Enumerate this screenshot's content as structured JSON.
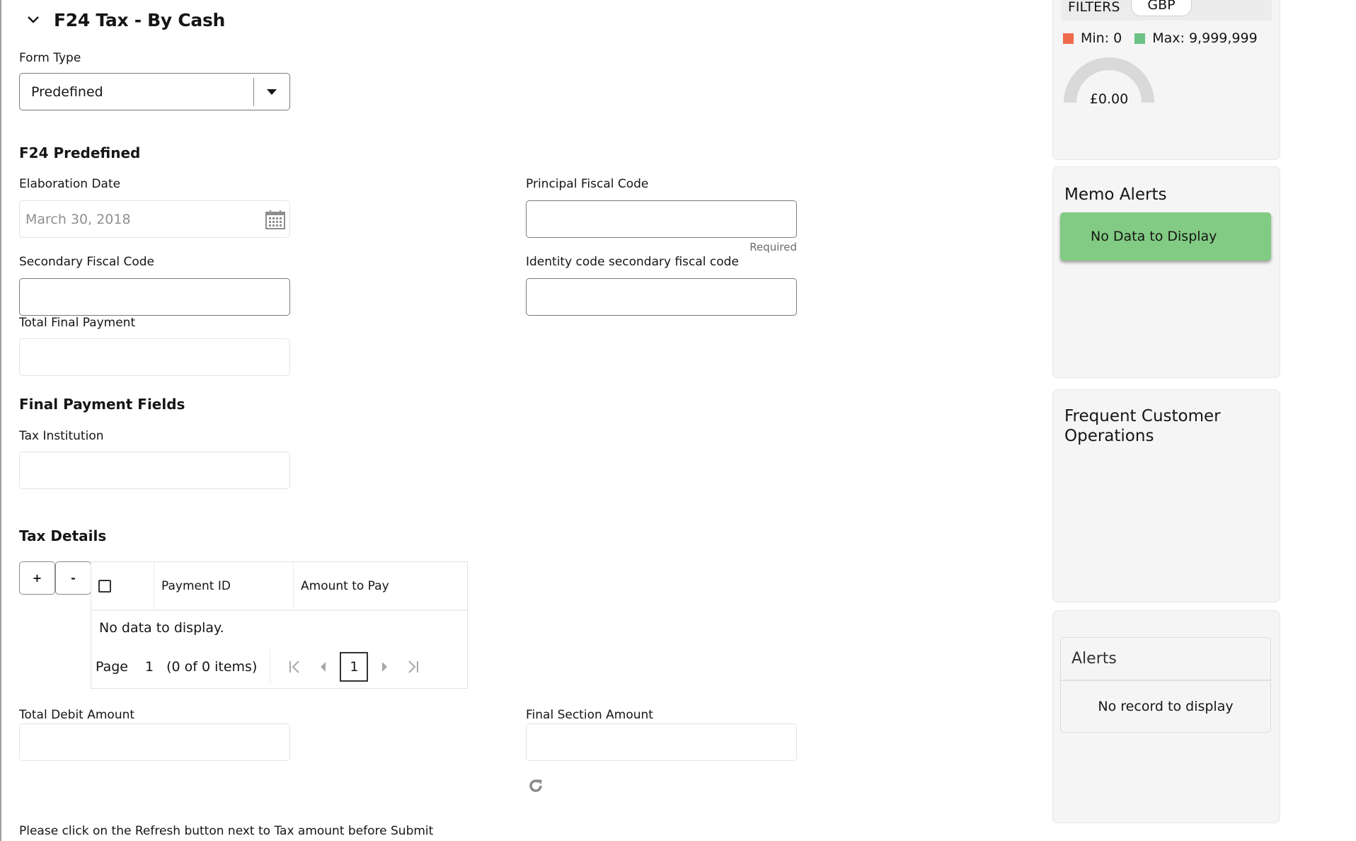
{
  "section": {
    "title": "F24 Tax - By Cash",
    "expanded": true
  },
  "form_type": {
    "label": "Form Type",
    "value": "Predefined"
  },
  "predefined": {
    "heading": "F24 Predefined",
    "elaboration_date": {
      "label": "Elaboration Date",
      "value": "March 30, 2018"
    },
    "principal_fiscal_code": {
      "label": "Principal Fiscal Code",
      "value": "",
      "hint": "Required"
    },
    "secondary_fiscal_code": {
      "label": "Secondary Fiscal Code",
      "value": ""
    },
    "identity_code": {
      "label": "Identity code secondary fiscal code",
      "value": ""
    },
    "total_final_payment": {
      "label": "Total Final Payment",
      "value": ""
    }
  },
  "final_payment": {
    "heading": "Final Payment Fields",
    "tax_institution": {
      "label": "Tax Institution",
      "value": ""
    }
  },
  "tax_details": {
    "heading": "Tax Details",
    "add_label": "+",
    "remove_label": "-",
    "columns": [
      "Payment ID",
      "Amount to Pay"
    ],
    "rows": [],
    "empty_text": "No data to display.",
    "pager": {
      "page_label": "Page",
      "current_page": "1",
      "items_text": "(0 of 0 items)",
      "page_input": "1"
    }
  },
  "totals": {
    "total_debit_amount": {
      "label": "Total Debit Amount",
      "value": ""
    },
    "final_section_amount": {
      "label": "Final Section Amount",
      "value": ""
    }
  },
  "footer_note": "Please click on the Refresh button next to Tax amount before Submit",
  "sidebar": {
    "limits": {
      "filters_label": "FILTERS",
      "currency": "GBP",
      "min_label": "Min: 0",
      "max_label": "Max: 9,999,999",
      "min_color": "#ee6a4d",
      "max_color": "#6cc184",
      "gauge_value": "£0.00",
      "gauge_fraction": 0
    },
    "memo_alerts": {
      "title": "Memo Alerts",
      "message": "No Data to Display",
      "color": "#82cb84"
    },
    "frequent_ops": {
      "title": "Frequent Customer Operations"
    },
    "alerts": {
      "title": "Alerts",
      "message": "No record to display"
    }
  }
}
